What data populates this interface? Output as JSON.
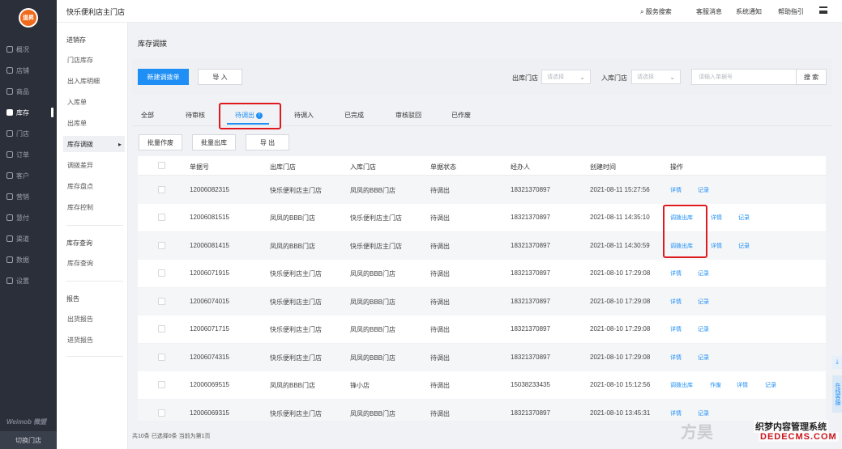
{
  "rail": {
    "logo_text": "道昇",
    "items": [
      {
        "label": "概况",
        "icon": "overview-icon"
      },
      {
        "label": "店铺",
        "icon": "store-icon"
      },
      {
        "label": "商品",
        "icon": "goods-icon"
      },
      {
        "label": "库存",
        "icon": "inventory-icon"
      },
      {
        "label": "门店",
        "icon": "shop-icon"
      },
      {
        "label": "订单",
        "icon": "order-icon"
      },
      {
        "label": "客户",
        "icon": "customer-icon"
      },
      {
        "label": "营销",
        "icon": "marketing-icon"
      },
      {
        "label": "慧付",
        "icon": "pay-icon"
      },
      {
        "label": "渠道",
        "icon": "channel-icon"
      },
      {
        "label": "数据",
        "icon": "data-icon"
      },
      {
        "label": "设置",
        "icon": "settings-icon"
      }
    ],
    "brand": "Weimob 微盟",
    "switch_store": "切换门店"
  },
  "submenu": {
    "group1": "进销存",
    "items1": [
      "门店库存",
      "出入库明细",
      "入库单",
      "出库单",
      "库存调拨",
      "调拨差异",
      "库存盘点",
      "库存控制"
    ],
    "group2": "库存查询",
    "items2": [
      "库存查询"
    ],
    "group3": "报告",
    "items3": [
      "出货报告",
      "进货报告"
    ]
  },
  "topbar": {
    "store_name": "快乐便利店主门店",
    "links": [
      "服务搜索",
      "客服消息",
      "系统通知",
      "帮助指引"
    ]
  },
  "page": {
    "title": "库存调拨",
    "new_button": "新建调拨单",
    "import_button": "导 入",
    "out_store_label": "出库门店",
    "out_store_placeholder": "请选择",
    "in_store_label": "入库门店",
    "in_store_placeholder": "请选择",
    "search_placeholder": "请输入单据号",
    "search_button": "搜 索"
  },
  "tabs": [
    {
      "label": "全部"
    },
    {
      "label": "待审核"
    },
    {
      "label": "待调出",
      "badge": "!"
    },
    {
      "label": "待调入"
    },
    {
      "label": "已完成"
    },
    {
      "label": "审核驳回"
    },
    {
      "label": "已作废"
    }
  ],
  "bulk": {
    "void": "批量作废",
    "out": "批量出库",
    "export": "导 出"
  },
  "table": {
    "headers": [
      "单据号",
      "出库门店",
      "入库门店",
      "单据状态",
      "经办人",
      "创建时间",
      "操作"
    ],
    "rows": [
      {
        "id": "12006082315",
        "out": "快乐便利店主门店",
        "in": "凤凤的BBB门店",
        "status": "待调出",
        "handler": "18321370897",
        "time": "2021-08-11 15:27:56",
        "ops": [
          "详情",
          "记录"
        ]
      },
      {
        "id": "12006081515",
        "out": "凤凤的BBB门店",
        "in": "快乐便利店主门店",
        "status": "待调出",
        "handler": "18321370897",
        "time": "2021-08-11 14:35:10",
        "ops": [
          "调拨出库",
          "详情",
          "记录"
        ]
      },
      {
        "id": "12006081415",
        "out": "凤凤的BBB门店",
        "in": "快乐便利店主门店",
        "status": "待调出",
        "handler": "18321370897",
        "time": "2021-08-11 14:30:59",
        "ops": [
          "调拨出库",
          "详情",
          "记录"
        ]
      },
      {
        "id": "12006071915",
        "out": "快乐便利店主门店",
        "in": "凤凤的BBB门店",
        "status": "待调出",
        "handler": "18321370897",
        "time": "2021-08-10 17:29:08",
        "ops": [
          "详情",
          "记录"
        ]
      },
      {
        "id": "12006074015",
        "out": "快乐便利店主门店",
        "in": "凤凤的BBB门店",
        "status": "待调出",
        "handler": "18321370897",
        "time": "2021-08-10 17:29:08",
        "ops": [
          "详情",
          "记录"
        ]
      },
      {
        "id": "12006071715",
        "out": "快乐便利店主门店",
        "in": "凤凤的BBB门店",
        "status": "待调出",
        "handler": "18321370897",
        "time": "2021-08-10 17:29:08",
        "ops": [
          "详情",
          "记录"
        ]
      },
      {
        "id": "12006074315",
        "out": "快乐便利店主门店",
        "in": "凤凤的BBB门店",
        "status": "待调出",
        "handler": "18321370897",
        "time": "2021-08-10 17:29:08",
        "ops": [
          "详情",
          "记录"
        ]
      },
      {
        "id": "12006069515",
        "out": "凤凤的BBB门店",
        "in": "锋小店",
        "status": "待调出",
        "handler": "15038233435",
        "time": "2021-08-10 15:12:56",
        "ops": [
          "调拨出库",
          "作废",
          "详情",
          "记录"
        ]
      },
      {
        "id": "12006069315",
        "out": "快乐便利店主门店",
        "in": "凤凤的BBB门店",
        "status": "待调出",
        "handler": "18321370897",
        "time": "2021-08-10 13:45:31",
        "ops": [
          "详情",
          "记录"
        ]
      }
    ]
  },
  "footer": "共10条 已选择0条 当前为第1页",
  "right_float": {
    "chat": "在线客服"
  },
  "watermark": {
    "line1": "织梦内容管理系统",
    "line2": "DEDECMS.COM",
    "faint": "方昊"
  },
  "colors": {
    "accent": "#1f8ff5",
    "highlight": "#e0191f",
    "rail": "#2b2f3a"
  }
}
